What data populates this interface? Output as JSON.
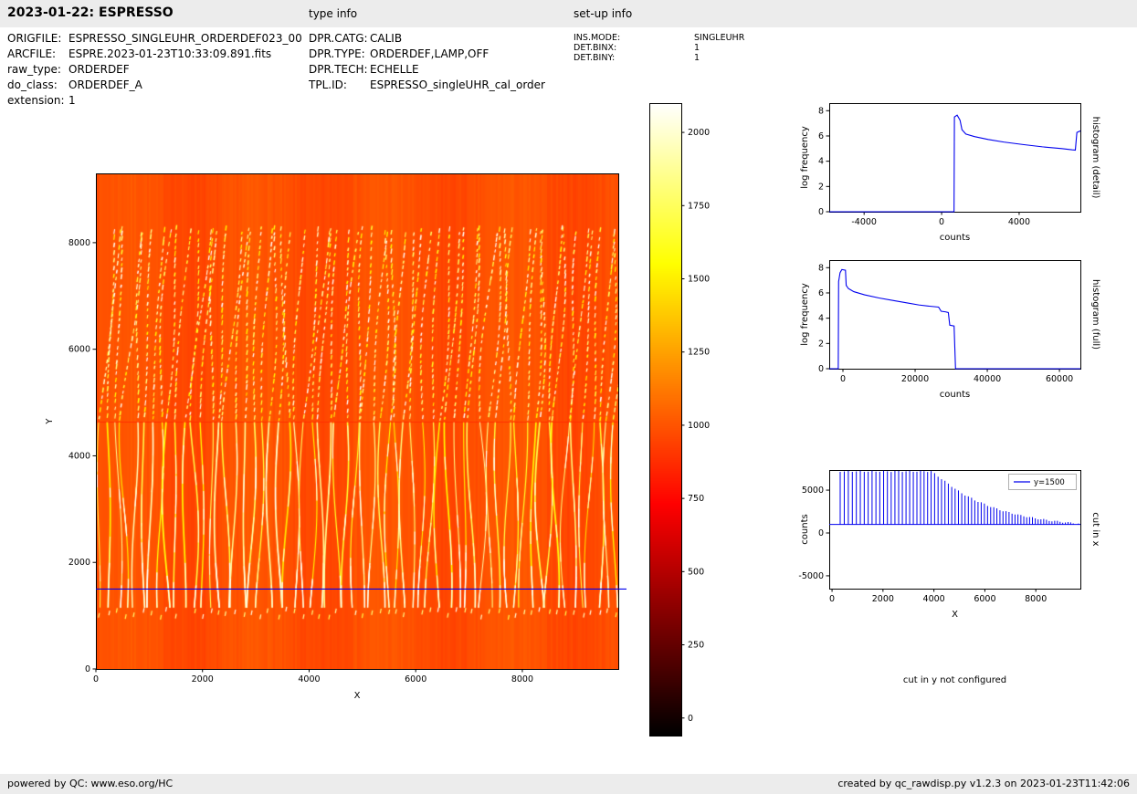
{
  "header": {
    "title": "2023-01-22: ESPRESSO",
    "type_info_label": "type info",
    "setup_info_label": "set-up info"
  },
  "file_info": {
    "rows": [
      {
        "label": "ORIGFILE:",
        "value": "ESPRESSO_SINGLEUHR_ORDERDEF023_00"
      },
      {
        "label": "ARCFILE:",
        "value": "ESPRE.2023-01-23T10:33:09.891.fits"
      },
      {
        "label": "raw_type:",
        "value": "ORDERDEF"
      },
      {
        "label": "do_class:",
        "value": "ORDERDEF_A"
      },
      {
        "label": "extension:",
        "value": "1"
      }
    ]
  },
  "type_info": {
    "rows": [
      {
        "label": "DPR.CATG:",
        "value": "CALIB"
      },
      {
        "label": "DPR.TYPE:",
        "value": "ORDERDEF,LAMP,OFF"
      },
      {
        "label": "DPR.TECH:",
        "value": "ECHELLE"
      },
      {
        "label": "TPL.ID:",
        "value": "ESPRESSO_singleUHR_cal_order"
      }
    ]
  },
  "setup_info": {
    "rows": [
      {
        "label": "INS.MODE:",
        "value": "SINGLEUHR"
      },
      {
        "label": "DET.BINX:",
        "value": "1"
      },
      {
        "label": "DET.BINY:",
        "value": "1"
      }
    ]
  },
  "cut_in_y_message": "cut in y not configured",
  "footer": {
    "left": "powered by QC: www.eso.org/HC",
    "right": "created by qc_rawdisp.py v1.2.3 on 2023-01-23T11:42:06"
  },
  "colors": {
    "bar_background": "#ececec",
    "plot_line_blue": "#0000ee",
    "spine_black": "#000000"
  },
  "chart_data": [
    {
      "id": "raw_image",
      "type": "heatmap",
      "xlabel": "X",
      "ylabel": "Y",
      "xlim": [
        0,
        9800
      ],
      "ylim": [
        0,
        9300
      ],
      "xticks": [
        0,
        2000,
        4000,
        6000,
        8000
      ],
      "yticks": [
        0,
        2000,
        4000,
        6000,
        8000
      ],
      "colormap": "hot",
      "color_range": [
        -60,
        2100
      ],
      "background_counts": 1000,
      "detector_gap_y": 4650,
      "cut_line": {
        "y": 1500,
        "color": "#0000ee"
      },
      "orders": {
        "count": 62,
        "x_start": 80,
        "x_end": 9760,
        "solid_band_y": [
          1150,
          4650
        ],
        "dashed_band_y": [
          4650,
          8250
        ],
        "tick_band_y": [
          920,
          1080
        ],
        "stripe_counts_min": 1450,
        "stripe_counts_max": 2150
      }
    },
    {
      "id": "colorbar",
      "type": "colorbar",
      "colormap": "hot",
      "range": [
        -60,
        2100
      ],
      "ticks": [
        0,
        250,
        500,
        750,
        1000,
        1250,
        1500,
        1750,
        2000
      ]
    },
    {
      "id": "histogram_detail",
      "type": "line",
      "side_label": "histogram (detail)",
      "xlabel": "counts",
      "ylabel": "log frequency",
      "xlim": [
        -5800,
        7160
      ],
      "ylim": [
        0,
        8.6
      ],
      "xticks": [
        -4000,
        0,
        4000
      ],
      "yticks": [
        0,
        2,
        4,
        6,
        8
      ],
      "color": "#0000ee",
      "points": [
        [
          -5800,
          0
        ],
        [
          640,
          0
        ],
        [
          660,
          7.5
        ],
        [
          800,
          7.65
        ],
        [
          950,
          7.25
        ],
        [
          1050,
          6.5
        ],
        [
          1250,
          6.15
        ],
        [
          1700,
          5.95
        ],
        [
          2400,
          5.72
        ],
        [
          3200,
          5.52
        ],
        [
          4200,
          5.32
        ],
        [
          5200,
          5.14
        ],
        [
          6200,
          5.0
        ],
        [
          6750,
          4.9
        ],
        [
          6900,
          4.88
        ],
        [
          6980,
          6.28
        ],
        [
          7160,
          6.4
        ]
      ]
    },
    {
      "id": "histogram_full",
      "type": "line",
      "side_label": "histogram (full)",
      "xlabel": "counts",
      "ylabel": "log frequency",
      "xlim": [
        -3800,
        65800
      ],
      "ylim": [
        0,
        8.6
      ],
      "xticks": [
        0,
        20000,
        40000,
        60000
      ],
      "yticks": [
        0,
        2,
        4,
        6,
        8
      ],
      "color": "#0000ee",
      "points": [
        [
          -3800,
          0
        ],
        [
          -1300,
          0
        ],
        [
          -1200,
          6.9
        ],
        [
          -800,
          7.6
        ],
        [
          -300,
          7.85
        ],
        [
          700,
          7.8
        ],
        [
          900,
          6.6
        ],
        [
          1500,
          6.35
        ],
        [
          3000,
          6.1
        ],
        [
          6000,
          5.85
        ],
        [
          10000,
          5.6
        ],
        [
          14000,
          5.4
        ],
        [
          18000,
          5.2
        ],
        [
          21000,
          5.05
        ],
        [
          24000,
          4.95
        ],
        [
          26500,
          4.88
        ],
        [
          27200,
          4.55
        ],
        [
          28500,
          4.5
        ],
        [
          29200,
          4.45
        ],
        [
          29600,
          3.45
        ],
        [
          30800,
          3.38
        ],
        [
          31200,
          0
        ],
        [
          65800,
          0
        ]
      ]
    },
    {
      "id": "cut_in_x",
      "type": "comb",
      "side_label": "cut in x",
      "xlabel": "X",
      "ylabel": "counts",
      "xlim": [
        -110,
        9750
      ],
      "ylim": [
        -6500,
        7350
      ],
      "xticks": [
        0,
        2000,
        4000,
        6000,
        8000
      ],
      "yticks": [
        -5000,
        0,
        5000
      ],
      "color": "#0000ee",
      "legend": "y=1500",
      "baseline": 1000,
      "spikes": {
        "x_start": 320,
        "x_end": 9680,
        "spacing_start": 160,
        "spacing_end": 100
      },
      "envelope": [
        [
          320,
          7200
        ],
        [
          3900,
          7200
        ],
        [
          4400,
          6100
        ],
        [
          5000,
          4800
        ],
        [
          5600,
          3850
        ],
        [
          6200,
          3100
        ],
        [
          6800,
          2500
        ],
        [
          7400,
          2050
        ],
        [
          8000,
          1700
        ],
        [
          8600,
          1430
        ],
        [
          9200,
          1230
        ],
        [
          9680,
          1100
        ]
      ]
    }
  ]
}
